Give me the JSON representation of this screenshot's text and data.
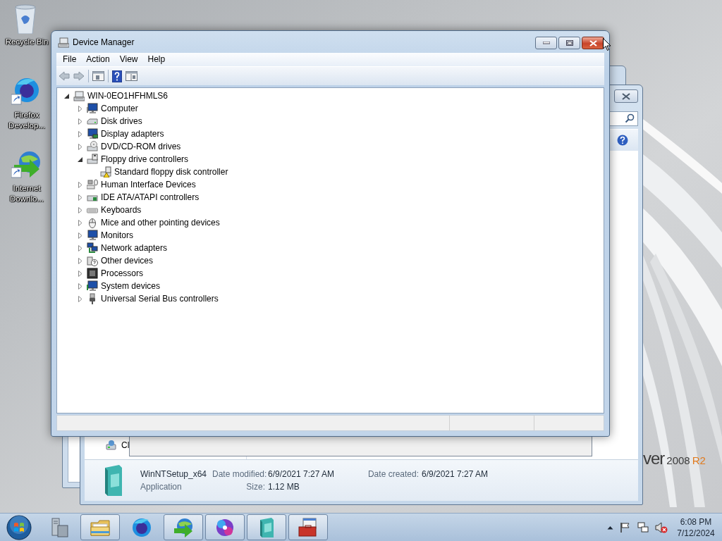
{
  "desktop_icons": [
    {
      "label": "Recycle Bin"
    },
    {
      "label": "Firefox Develop..."
    },
    {
      "label": "Internet Downlo..."
    }
  ],
  "wallpaper_logo": [
    "ver",
    "2008",
    "R2"
  ],
  "explorer": {
    "nav_item": "Cl",
    "details": {
      "name": "WinNTSetup_x64",
      "type": "Application",
      "modified": {
        "label": "Date modified:",
        "value": "6/9/2021 7:27 AM"
      },
      "created": {
        "label": "Date created:",
        "value": "6/9/2021 7:27 AM"
      },
      "size": {
        "label": "Size:",
        "value": "1.12 MB"
      }
    }
  },
  "device_manager": {
    "title": "Device Manager",
    "menu": [
      "File",
      "Action",
      "View",
      "Help"
    ],
    "tree": {
      "label": "WIN-0EO1HFHMLS6",
      "expanded": true,
      "children": [
        {
          "label": "Computer",
          "expanded": false
        },
        {
          "label": "Disk drives",
          "expanded": false
        },
        {
          "label": "Display adapters",
          "expanded": false
        },
        {
          "label": "DVD/CD-ROM drives",
          "expanded": false
        },
        {
          "label": "Floppy drive controllers",
          "expanded": true,
          "children": [
            {
              "label": "Standard floppy disk controller"
            }
          ]
        },
        {
          "label": "Human Interface Devices",
          "expanded": false
        },
        {
          "label": "IDE ATA/ATAPI controllers",
          "expanded": false
        },
        {
          "label": "Keyboards",
          "expanded": false
        },
        {
          "label": "Mice and other pointing devices",
          "expanded": false
        },
        {
          "label": "Monitors",
          "expanded": false
        },
        {
          "label": "Network adapters",
          "expanded": false
        },
        {
          "label": "Other devices",
          "expanded": false
        },
        {
          "label": "Processors",
          "expanded": false
        },
        {
          "label": "System devices",
          "expanded": false
        },
        {
          "label": "Universal Serial Bus controllers",
          "expanded": false
        }
      ]
    }
  },
  "taskbar": {
    "apps": [
      {
        "open": false
      },
      {
        "open": true
      },
      {
        "open": false
      },
      {
        "open": true
      },
      {
        "open": true
      },
      {
        "open": true
      },
      {
        "open": true
      }
    ],
    "clock": {
      "time": "6:08 PM",
      "date": "7/12/2024"
    }
  }
}
